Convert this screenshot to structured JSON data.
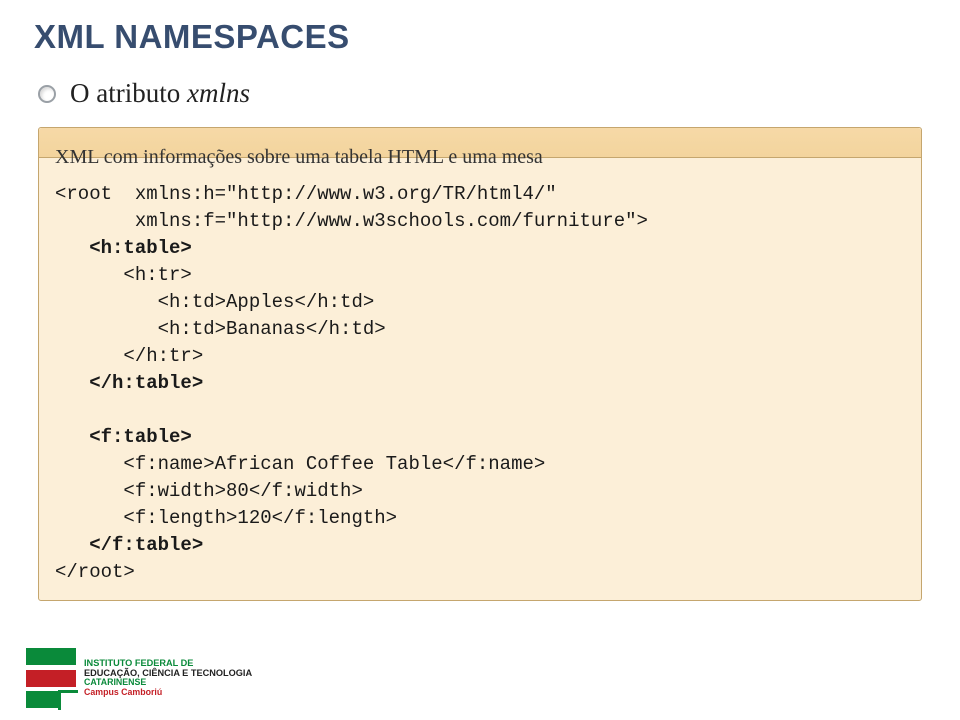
{
  "title_prefix": "XML N",
  "title_rest": "AMESPACES",
  "bullet": {
    "label_full": "O atributo xmlns",
    "label_static": "O atributo ",
    "label_italic": "xmlns"
  },
  "code": {
    "header": "XML com informações sobre uma tabela HTML e uma mesa",
    "line01_a": "<root  xmlns:h=\"http://www.w3.org/TR/html4/\"",
    "line02_a": "       xmlns:f=\"http://www.w3schools.com/furniture\">",
    "line03_a": "   ",
    "line03_b": "<h:table>",
    "line04_a": "      <h:tr>",
    "line05_a": "         <h:td>Apples</h:td>",
    "line06_a": "         <h:td>Bananas</h:td>",
    "line07_a": "      </h:tr>",
    "line08_a": "   ",
    "line08_b": "</h:table>",
    "blank": " ",
    "line10_a": "   ",
    "line10_b": "<f:table>",
    "line11_a": "      <f:name>African Coffee Table</f:name>",
    "line12_a": "      <f:width>80</f:width>",
    "line13_a": "      <f:length>120</f:length>",
    "line14_a": "   ",
    "line14_b": "</f:table>",
    "line15_a": "</root>"
  },
  "footer": {
    "line1": "INSTITUTO FEDERAL DE",
    "line2": "EDUCAÇÃO, CIÊNCIA E TECNOLOGIA",
    "line3": "CATARINENSE",
    "line4": "Campus Camboriú"
  }
}
